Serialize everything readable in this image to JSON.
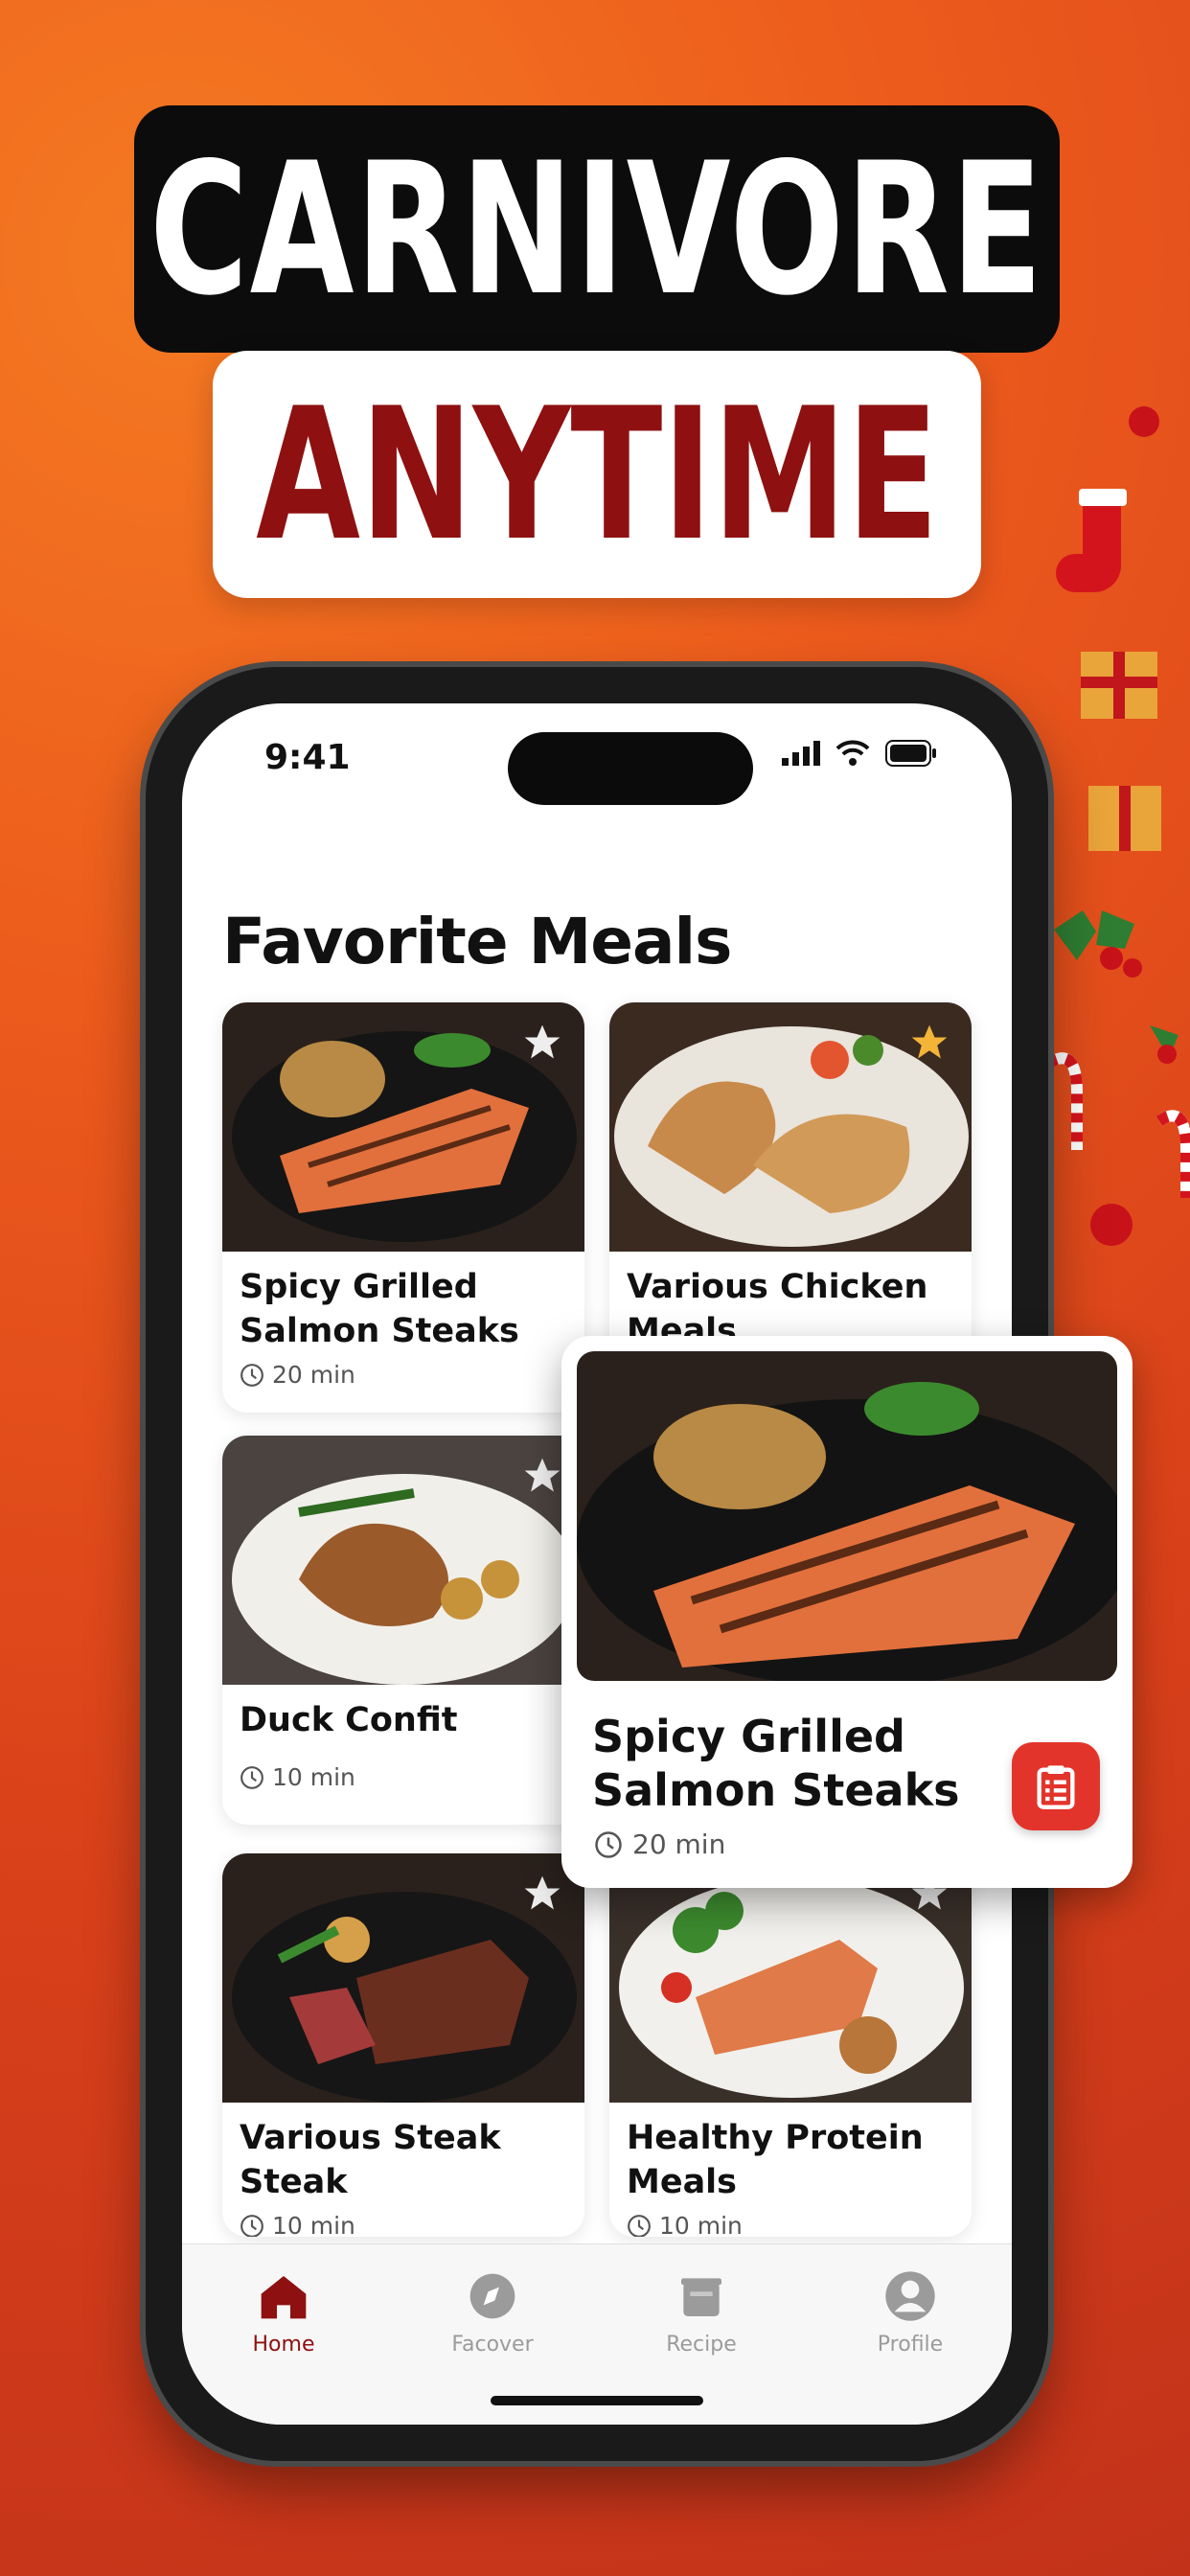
{
  "headline": {
    "line1": "CARNIVORE",
    "line2": "ANYTIME"
  },
  "status_bar": {
    "time": "9:41"
  },
  "page_title": "Favorite Meals",
  "cards": [
    {
      "title": "Spicy Grilled Salmon Steaks",
      "time": "20 min",
      "favorite": false,
      "image": "grilled-salmon"
    },
    {
      "title": "Various Chicken Meals",
      "time": "",
      "favorite": true,
      "image": "grilled-chicken"
    },
    {
      "title": "Duck Confit",
      "time": "10 min",
      "favorite": false,
      "image": "duck-confit"
    },
    {
      "title": "Various Steak Steak",
      "time": "10 min",
      "favorite": false,
      "image": "sliced-steak"
    },
    {
      "title": "Healthy Protein Meals",
      "time": "10 min",
      "favorite": false,
      "image": "salmon-protein-plate"
    }
  ],
  "popup": {
    "title": "Spicy Grilled Salmon Steaks",
    "time": "20 min",
    "action_icon": "clipboard-icon"
  },
  "tabs": [
    {
      "label": "Home",
      "icon": "home-icon",
      "active": true
    },
    {
      "label": "Facover",
      "icon": "compass-icon",
      "active": false
    },
    {
      "label": "Recipe",
      "icon": "pot-icon",
      "active": false
    },
    {
      "label": "Profile",
      "icon": "profile-icon",
      "active": false
    }
  ],
  "colors": {
    "accent": "#8e1010",
    "background": "#e4501c",
    "button": "#e3342b",
    "star_active": "#f3b437"
  }
}
